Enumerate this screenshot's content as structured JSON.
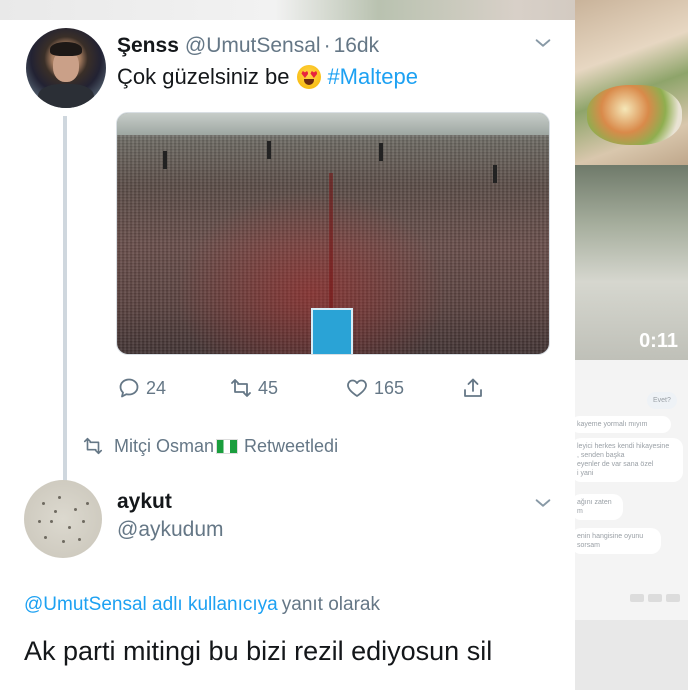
{
  "background": {
    "video_duration": "0:11",
    "chat_messages": [
      {
        "text": "Evet?",
        "side": "right"
      },
      {
        "text": "kayeme yormalı mıyım",
        "side": "left"
      },
      {
        "text": "leyici herkes kendi hikayesine\n, senden başka\neyenler de var sana özel\ni yani",
        "side": "left"
      },
      {
        "text": "ağını zaten\nm",
        "side": "left"
      },
      {
        "text": "enin hangisine oyunu\nsorsam",
        "side": "left"
      }
    ]
  },
  "tweet": {
    "display_name": "Şenss",
    "handle": "@UmutSensal",
    "separator": "·",
    "time": "16dk",
    "text_before_emoji": "Çok güzelsiniz be",
    "emoji": "heart-eyes-emoji",
    "hashtag": "#Maltepe",
    "actions": {
      "reply_count": "24",
      "retweet_count": "45",
      "like_count": "165"
    }
  },
  "retweet_banner": {
    "user": "Mitçi Osman",
    "flag": "nigeria-flag",
    "label": "Retweetledi"
  },
  "reply": {
    "display_name": "aykut",
    "handle": "@aykudum",
    "reply_to_mention": "@UmutSensal adlı kullanıcıya",
    "reply_to_suffix": "yanıt olarak",
    "text_line_1": "Ak parti mitingi bu bizi rezil ediyosun sil",
    "text_line_2": ""
  },
  "colors": {
    "link_blue": "#1da1f2",
    "secondary_gray": "#657786",
    "primary_text": "#14171a"
  }
}
